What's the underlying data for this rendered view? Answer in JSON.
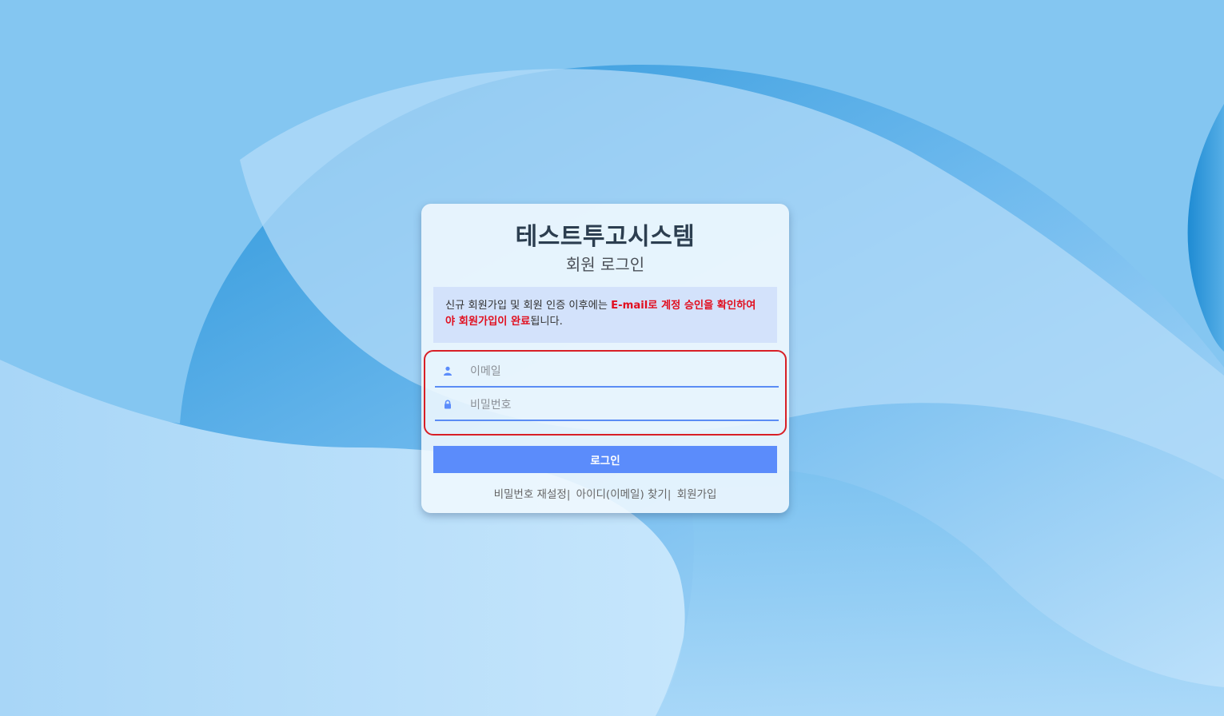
{
  "app": {
    "title": "테스트투고시스템",
    "subtitle": "회원 로그인"
  },
  "notice": {
    "text_before": "신규 회원가입 및 회원 인증 이후에는 ",
    "highlight_1": "E-mail로 계정 승인을 확인하여야 회원가입이 완료",
    "text_after": "됩니다."
  },
  "form": {
    "email": {
      "placeholder": "이메일",
      "value": "",
      "icon": "user-icon"
    },
    "password": {
      "placeholder": "비밀번호",
      "value": "",
      "icon": "lock-icon"
    },
    "login_label": "로그인"
  },
  "links": {
    "reset_password": "비밀번호 재설정",
    "find_id": "아이디(이메일) 찾기",
    "signup": "회원가입",
    "separator": "|"
  },
  "colors": {
    "accent": "#5b8cfb",
    "highlight_text": "#e10f1f",
    "notice_bg": "#d3e2fb",
    "focus_outline": "#d81f26"
  }
}
